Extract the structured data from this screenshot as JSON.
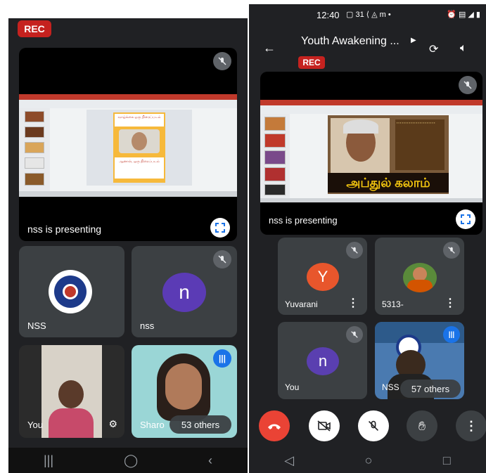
{
  "left": {
    "rec": "REC",
    "presenting": "nss is presenting",
    "tiles": {
      "nss_logo_name": "NSS",
      "nss_avatar_letter": "n",
      "nss_name": "nss",
      "you_name": "You",
      "sharo_name": "Sharo",
      "others": "53 others"
    },
    "slide": {
      "top_caption": "வாழ்க்கை ஒரு திரைப்படம்",
      "bottom_caption": "ஆனால், ஒரு திரைப்படம்"
    },
    "nav": [
      "|||",
      "◯",
      "‹"
    ]
  },
  "right": {
    "status": {
      "time": "12:40",
      "icons": "▢ 31 ⟨ ◬ m •"
    },
    "meeting_title": "Youth Awakening ...",
    "rec": "REC",
    "presenting": "nss is presenting",
    "slide_caption": "அப்துல் கலாம்",
    "tiles": {
      "yuvarani_letter": "Y",
      "yuvarani_name": "Yuvarani",
      "p5313_name": "5313-",
      "you_letter": "n",
      "you_name": "You",
      "nss_name": "NSS",
      "others": "57 others"
    },
    "nav": [
      "◁",
      "○",
      "□"
    ]
  },
  "colors": {
    "background": "#202124",
    "tile": "#3c4043",
    "rec": "#c5221f",
    "hangup": "#ea4335",
    "avatar_purple": "#5b3bb5",
    "avatar_orange": "#e8562c",
    "avatar_purple_right": "#5a3fb0",
    "accent_blue": "#1a73e8"
  }
}
